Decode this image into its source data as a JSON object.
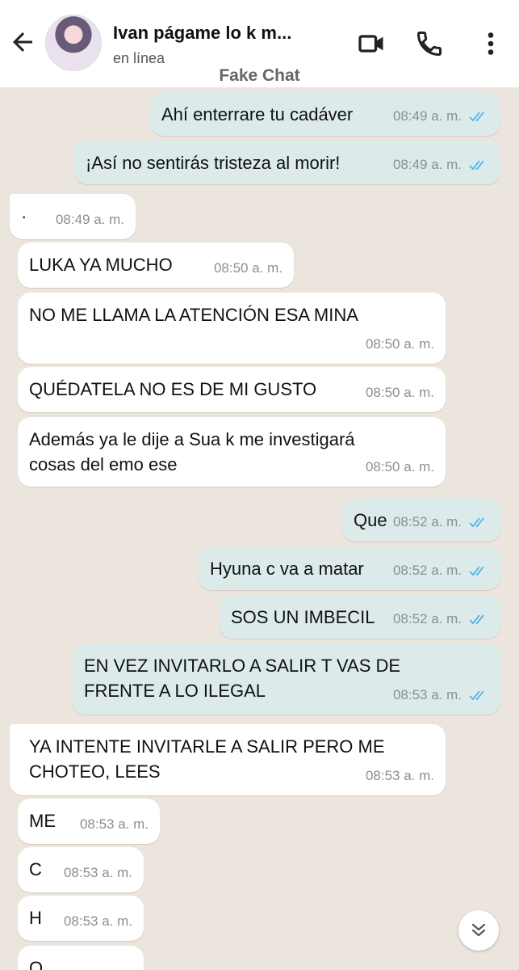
{
  "header": {
    "contact_name": "Ivan págame lo k m...",
    "status": "en línea",
    "app_label": "Fake Chat",
    "icons": [
      "back-arrow-icon",
      "avatar",
      "video-call-icon",
      "phone-call-icon",
      "more-options-icon"
    ]
  },
  "colors": {
    "outgoing_bubble": "#dcebea",
    "incoming_bubble": "#ffffff",
    "read_ticks": "#4fb3e8",
    "background": "#ece5dd"
  },
  "messages": [
    {
      "dir": "out",
      "text": "Ahí enterrare tu cadáver",
      "time": "08:49 a. m.",
      "read": true
    },
    {
      "dir": "out",
      "text": "¡Así no sentirás tristeza al morir!",
      "time": "08:49 a. m.",
      "read": true
    },
    {
      "dir": "in",
      "text": "·",
      "time": "08:49 a. m."
    },
    {
      "dir": "in",
      "text": "LUKA YA MUCHO",
      "time": "08:50 a. m."
    },
    {
      "dir": "in",
      "text": "NO ME LLAMA LA ATENCIÓN ESA MINA",
      "time": "08:50 a. m."
    },
    {
      "dir": "in",
      "text": "QUÉDATELA NO ES DE MI GUSTO",
      "time": "08:50 a. m."
    },
    {
      "dir": "in",
      "text": "Además ya le dije a Sua k me investigará\ncosas del emo ese",
      "time": "08:50 a. m."
    },
    {
      "dir": "out",
      "text": "Que",
      "time": "08:52 a. m.",
      "read": true
    },
    {
      "dir": "out",
      "text": "Hyuna c va a matar",
      "time": "08:52 a. m.",
      "read": true
    },
    {
      "dir": "out",
      "text": "SOS UN IMBECIL",
      "time": "08:52 a. m.",
      "read": true
    },
    {
      "dir": "out",
      "text": "EN VEZ INVITARLO A SALIR T VAS DE\nFRENTE A LO ILEGAL",
      "time": "08:53 a. m.",
      "read": true
    },
    {
      "dir": "in",
      "text": "YA INTENTE INVITARLE A SALIR PERO ME\nCHOTEO, LEES",
      "time": "08:53 a. m."
    },
    {
      "dir": "in",
      "text": "ME",
      "time": "08:53 a. m."
    },
    {
      "dir": "in",
      "text": "C",
      "time": "08:53 a. m."
    },
    {
      "dir": "in",
      "text": "H",
      "time": "08:53 a. m."
    },
    {
      "dir": "in",
      "text": "O",
      "time": ""
    }
  ],
  "scroll_button": {
    "icon": "double-chevron-down-icon"
  }
}
